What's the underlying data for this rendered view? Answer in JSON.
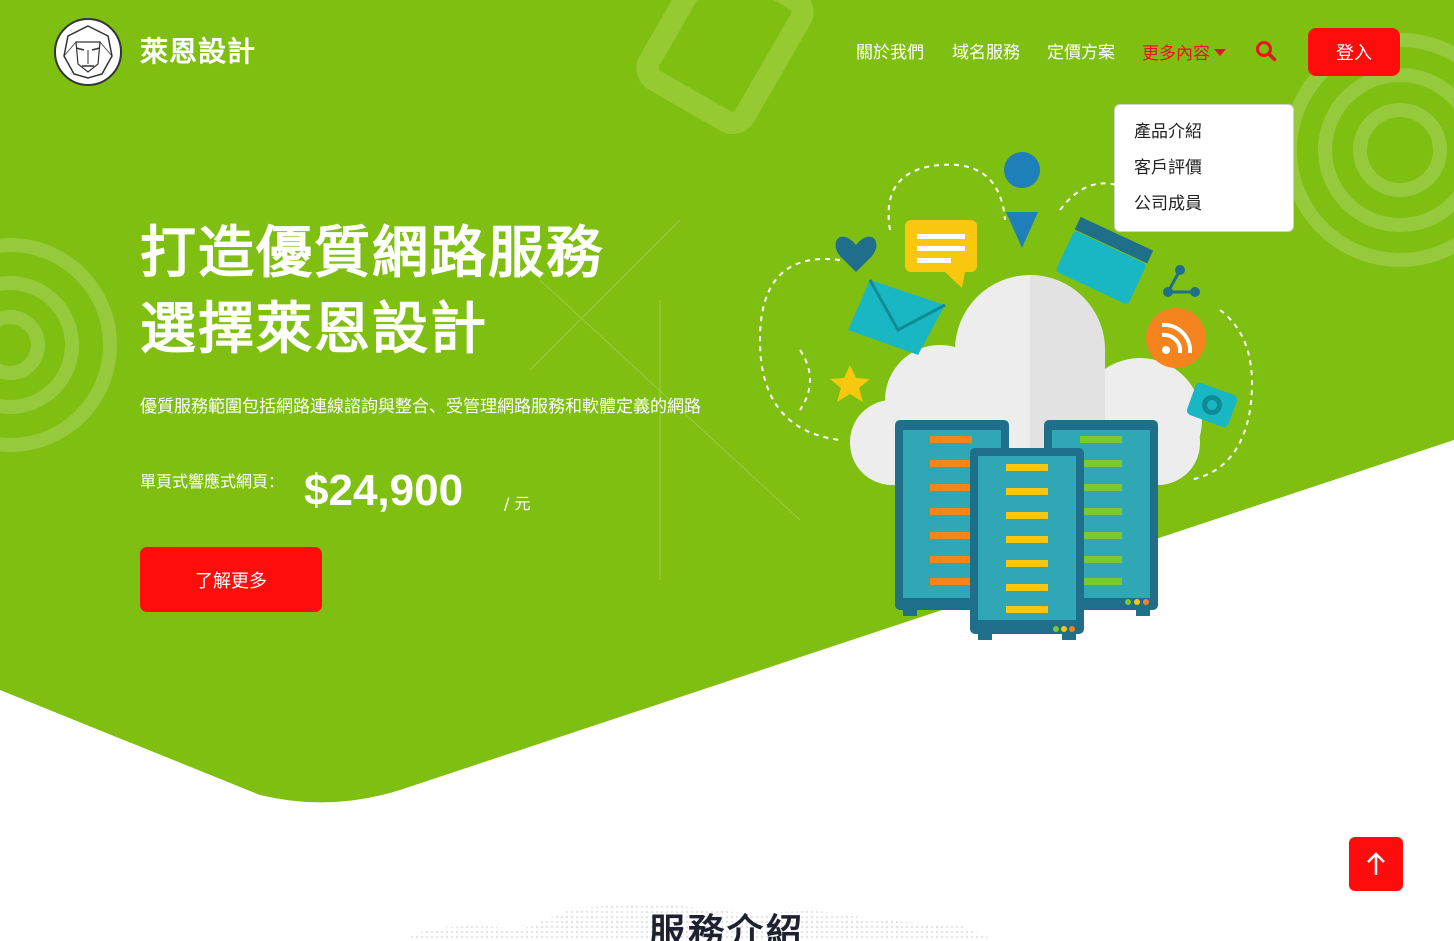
{
  "header": {
    "brand": "萊恩設計",
    "nav": {
      "about": "關於我們",
      "domain": "域名服務",
      "pricing": "定價方案",
      "more": "更多內容"
    },
    "login": "登入"
  },
  "dropdown": {
    "items": [
      "產品介紹",
      "客戶評價",
      "公司成員"
    ]
  },
  "hero": {
    "title_line1": "打造優質網路服務",
    "title_line2": "選擇萊恩設計",
    "description": "優質服務範圍包括網路連線諮詢與整合、受管理網路服務和軟體定義的網路",
    "price_label": "單頁式響應式網頁：",
    "price_value": "$24,900",
    "price_unit": "/ 元",
    "cta": "了解更多"
  },
  "services": {
    "title": "服務介紹"
  },
  "colors": {
    "hero_green": "#7fbf12",
    "accent_red": "#ff0d0d",
    "nav_active": "#e8131f"
  },
  "icons": [
    "lion-logo-icon",
    "caret-down-icon",
    "search-icon",
    "arrow-up-icon"
  ]
}
